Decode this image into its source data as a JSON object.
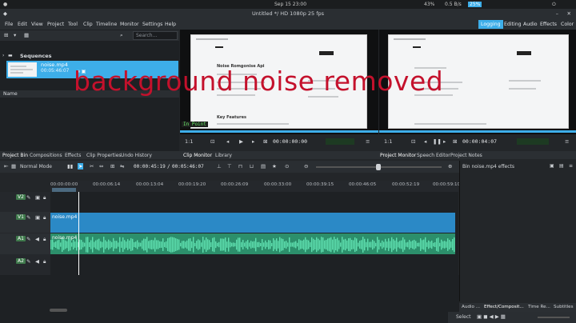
{
  "system": {
    "date": "Sep 15  23:00",
    "battery": "43%",
    "net": "0.5 B/s",
    "ram": "25%"
  },
  "window": {
    "title": "Untitled */ HD 1080p 25 fps"
  },
  "menu": [
    "File",
    "Edit",
    "View",
    "Project",
    "Tool",
    "Clip",
    "Timeline",
    "Monitor",
    "Settings",
    "Help"
  ],
  "workspaces": [
    {
      "label": "Logging",
      "active": true
    },
    {
      "label": "Editing",
      "active": false
    },
    {
      "label": "Audio",
      "active": false
    },
    {
      "label": "Effects",
      "active": false
    },
    {
      "label": "Color",
      "active": false
    }
  ],
  "bin": {
    "search_placeholder": "Search...",
    "folder": "Sequences",
    "clip_name": "noise.mp4",
    "clip_duration": "00:05:46:07",
    "column": "Name"
  },
  "overlay_text": "background noise removed",
  "clip_monitor": {
    "in_point": "In Point",
    "zoom": "1:1",
    "timecode": "00:00:00:00"
  },
  "project_monitor": {
    "zoom": "1:1",
    "timecode": "00:00:04:07"
  },
  "doc_page": {
    "heading": "Noise Romgonise Api",
    "sub": "Key Features"
  },
  "tabs_left": [
    "Project Bin",
    "Compositions",
    "Effects",
    "Clip Properties",
    "Undo History"
  ],
  "tabs_mid": [
    "Clip Monitor",
    "Library"
  ],
  "tabs_right": [
    "Project Monitor",
    "Speech Editor",
    "Project Notes"
  ],
  "timeline": {
    "mode": "Normal Mode",
    "position": "00:00:45:19",
    "duration": "00:05:46:07",
    "ruler": [
      "00:00:00:00",
      "00:00:06:14",
      "00:00:13:04",
      "00:00:19:20",
      "00:00:26:09",
      "00:00:33:00",
      "00:00:39:15",
      "00:00:46:05",
      "00:00:52:19",
      "00:00:59:10"
    ],
    "tracks": [
      {
        "id": "V2",
        "clip": ""
      },
      {
        "id": "V1",
        "clip": "noise.mp4"
      },
      {
        "id": "A1",
        "clip": "noise.mp4"
      },
      {
        "id": "A2",
        "clip": ""
      }
    ]
  },
  "effects_panel": {
    "title": "Bin noise.mp4 effects"
  },
  "bottom_tabs": [
    "Audio ...",
    "Effect/Composit...",
    "Time Re...",
    "Subtitles"
  ],
  "status": {
    "select": "Select"
  },
  "colors": {
    "accent": "#3daee9",
    "video_clip": "#2b89c6",
    "audio_clip": "#2c8f6b",
    "overlay": "#c4112c"
  }
}
